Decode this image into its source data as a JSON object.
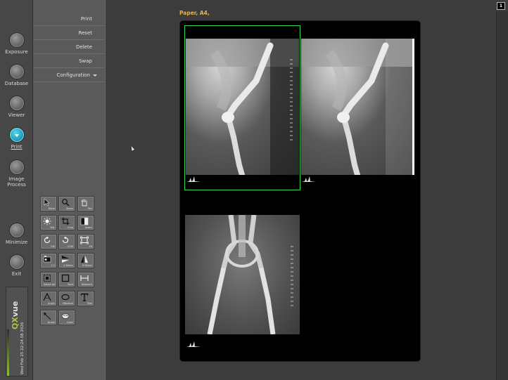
{
  "nav": {
    "items": [
      {
        "label": "Exposure",
        "active": false
      },
      {
        "label": "Database",
        "active": false
      },
      {
        "label": "Viewer",
        "active": false
      },
      {
        "label": "Print",
        "active": true
      },
      {
        "label": "Image\nProcess",
        "active": false
      },
      {
        "label": "Minimize",
        "active": false
      },
      {
        "label": "Exit",
        "active": false
      }
    ]
  },
  "brand": {
    "logo_q": "Q",
    "logo_x": "X",
    "logo_rest": "vue",
    "datetime": "Wed Feb 25 22:24.08 2026"
  },
  "menu": {
    "print": "Print",
    "reset": "Reset",
    "delete": "Delete",
    "swap": "Swap",
    "configuration": "Configuration"
  },
  "tools": [
    {
      "label": "Move",
      "icon": "pointer-icon"
    },
    {
      "label": "Zoom",
      "icon": "magnifier-icon"
    },
    {
      "label": "Pan",
      "icon": "hand-icon"
    },
    {
      "label": "W/L",
      "icon": "brightness-icon"
    },
    {
      "label": "Crop",
      "icon": "crop-icon"
    },
    {
      "label": "Invert",
      "icon": "invert-icon"
    },
    {
      "label": "CW",
      "icon": "rotate-cw-icon"
    },
    {
      "label": "CCW",
      "icon": "rotate-ccw-icon"
    },
    {
      "label": "Fit",
      "icon": "fit-icon"
    },
    {
      "label": "1:1",
      "icon": "actual-size-icon"
    },
    {
      "label": "V Mirror",
      "icon": "vertical-mirror-icon"
    },
    {
      "label": "H Mirror",
      "icon": "horizontal-mirror-icon"
    },
    {
      "label": "Select all",
      "icon": "select-all-icon"
    },
    {
      "label": "Rect",
      "icon": "rectangle-icon"
    },
    {
      "label": "Distance",
      "icon": "distance-icon"
    },
    {
      "label": "Angle",
      "icon": "angle-icon"
    },
    {
      "label": "Elliptical",
      "icon": "ellipse-icon"
    },
    {
      "label": "Text",
      "icon": "text-icon"
    },
    {
      "label": "Arrow",
      "icon": "arrow-icon"
    },
    {
      "label": "Color",
      "icon": "palette-icon"
    }
  ],
  "workspace": {
    "paper_label": "Paper, A4,",
    "page_number": "1"
  },
  "colors": {
    "accent": "#1f9fbf",
    "paper_label": "#e6b44a",
    "selection": "#2fd84f",
    "brand_green": "#a9c24a"
  }
}
